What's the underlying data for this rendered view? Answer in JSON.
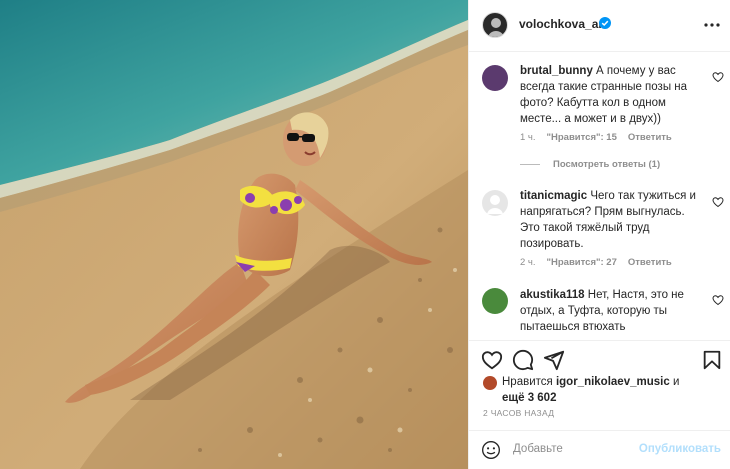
{
  "post": {
    "author": "volochkova_art",
    "photo_alt_icon": "beach-photo"
  },
  "comments": [
    {
      "username": "brutal_bunny",
      "text": "А почему у вас всегда такие странные позы на фото? Кабутта кол в одном месте... а может и в двух))",
      "time": "1 ч.",
      "likes": "\"Нравится\": 15",
      "reply": "Ответить",
      "replies_label": "Посмотреть ответы (1)"
    },
    {
      "username": "titanicmagic",
      "text": "Чего так тужиться и напрягаться? Прям выгнулась. Это такой тяжёлый труд позировать.",
      "time": "2 ч.",
      "likes": "\"Нравится\": 27",
      "reply": "Ответить"
    },
    {
      "username": "akustika118",
      "text": "Нет, Настя, это не отдых, а Туфта, которую ты пытаешься втюхать"
    }
  ],
  "likes": {
    "prefix": "Нравится",
    "user": "igor_nikolaev_music",
    "suffix": "и",
    "more": "ещё 3 602"
  },
  "timestamp": "2 ЧАСОВ НАЗАД",
  "add_comment": {
    "placeholder": "Добавьте",
    "publish": "Опубликовать"
  },
  "colors": {
    "accent": "#0095f6",
    "publish_disabled": "#b2dffc",
    "muted": "#8e8e8e"
  }
}
